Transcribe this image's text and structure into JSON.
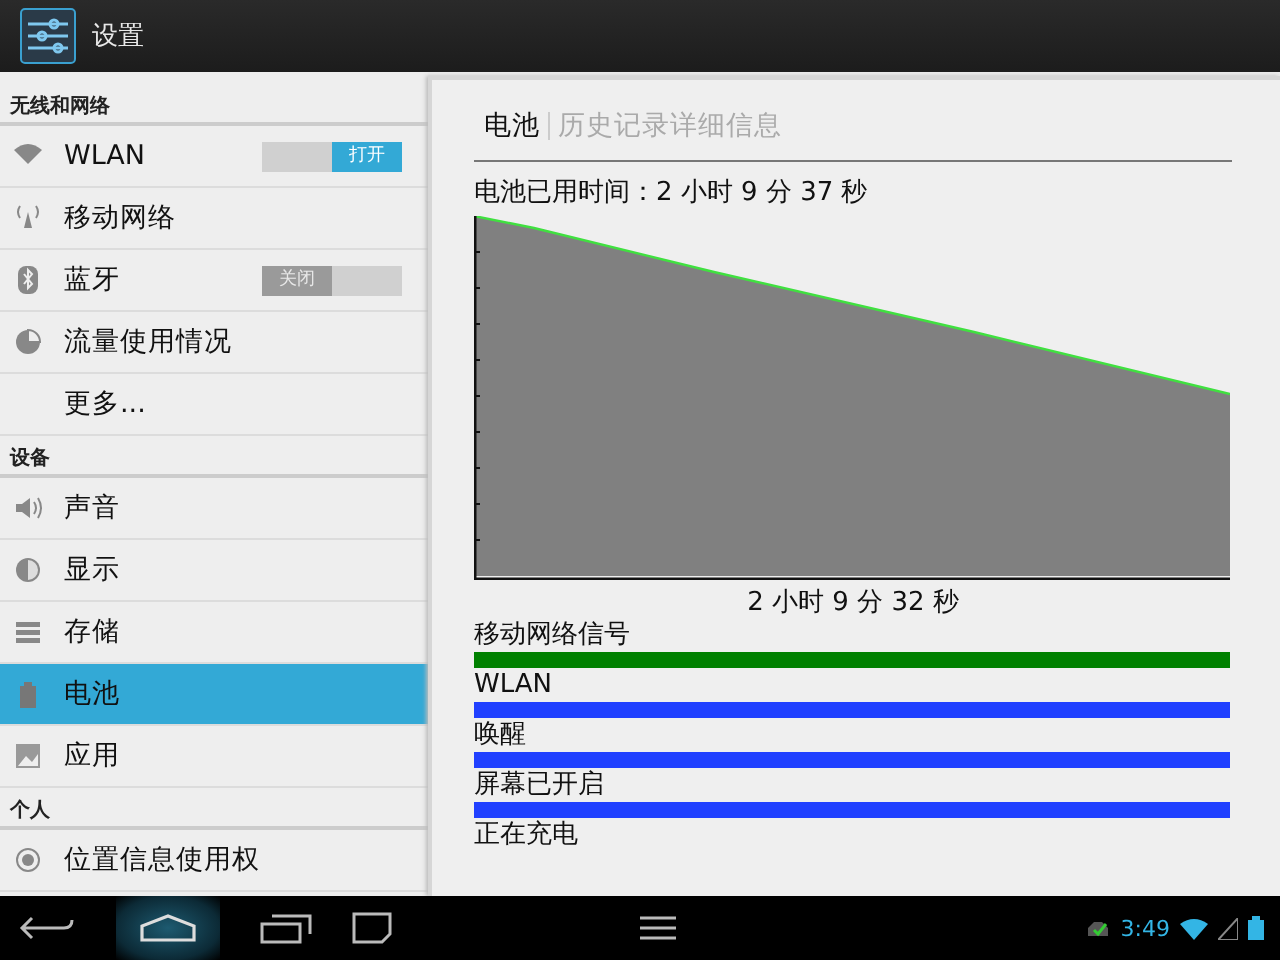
{
  "action_bar": {
    "title": "设置"
  },
  "sidebar": {
    "sections": [
      {
        "header": "无线和网络",
        "items": [
          {
            "label": "WLAN",
            "selected": false,
            "toggle": {
              "label": "打开",
              "on": true
            }
          },
          {
            "label": "移动网络",
            "selected": false
          },
          {
            "label": "蓝牙",
            "selected": false,
            "toggle": {
              "label": "关闭",
              "on": false
            }
          },
          {
            "label": "流量使用情况",
            "selected": false
          },
          {
            "label": "更多...",
            "selected": false
          }
        ]
      },
      {
        "header": "设备",
        "items": [
          {
            "label": "声音",
            "selected": false
          },
          {
            "label": "显示",
            "selected": false
          },
          {
            "label": "存储",
            "selected": false
          },
          {
            "label": "电池",
            "selected": true
          },
          {
            "label": "应用",
            "selected": false
          }
        ]
      },
      {
        "header": "个人",
        "items": [
          {
            "label": "位置信息使用权",
            "selected": false
          }
        ]
      }
    ]
  },
  "detail": {
    "tabs": [
      {
        "label": "电池",
        "selected": true
      },
      {
        "label": "历史记录详细信息",
        "selected": false
      }
    ],
    "battery_time": "电池已用时间：2 小时 9 分 37 秒",
    "graph_time": "2 小时 9 分 32 秒",
    "signals": [
      {
        "label": "移动网络信号",
        "kind": "bar",
        "color": "#008000"
      },
      {
        "label": "WLAN",
        "kind": "bar",
        "color": "#2040ff"
      },
      {
        "label": "唤醒",
        "kind": "bar",
        "color": "#2040ff"
      },
      {
        "label": "屏幕已开启",
        "kind": "bar",
        "color": "#2040ff"
      },
      {
        "label": "正在充电",
        "kind": "none"
      }
    ]
  },
  "status_bar": {
    "time": "3:49"
  }
}
